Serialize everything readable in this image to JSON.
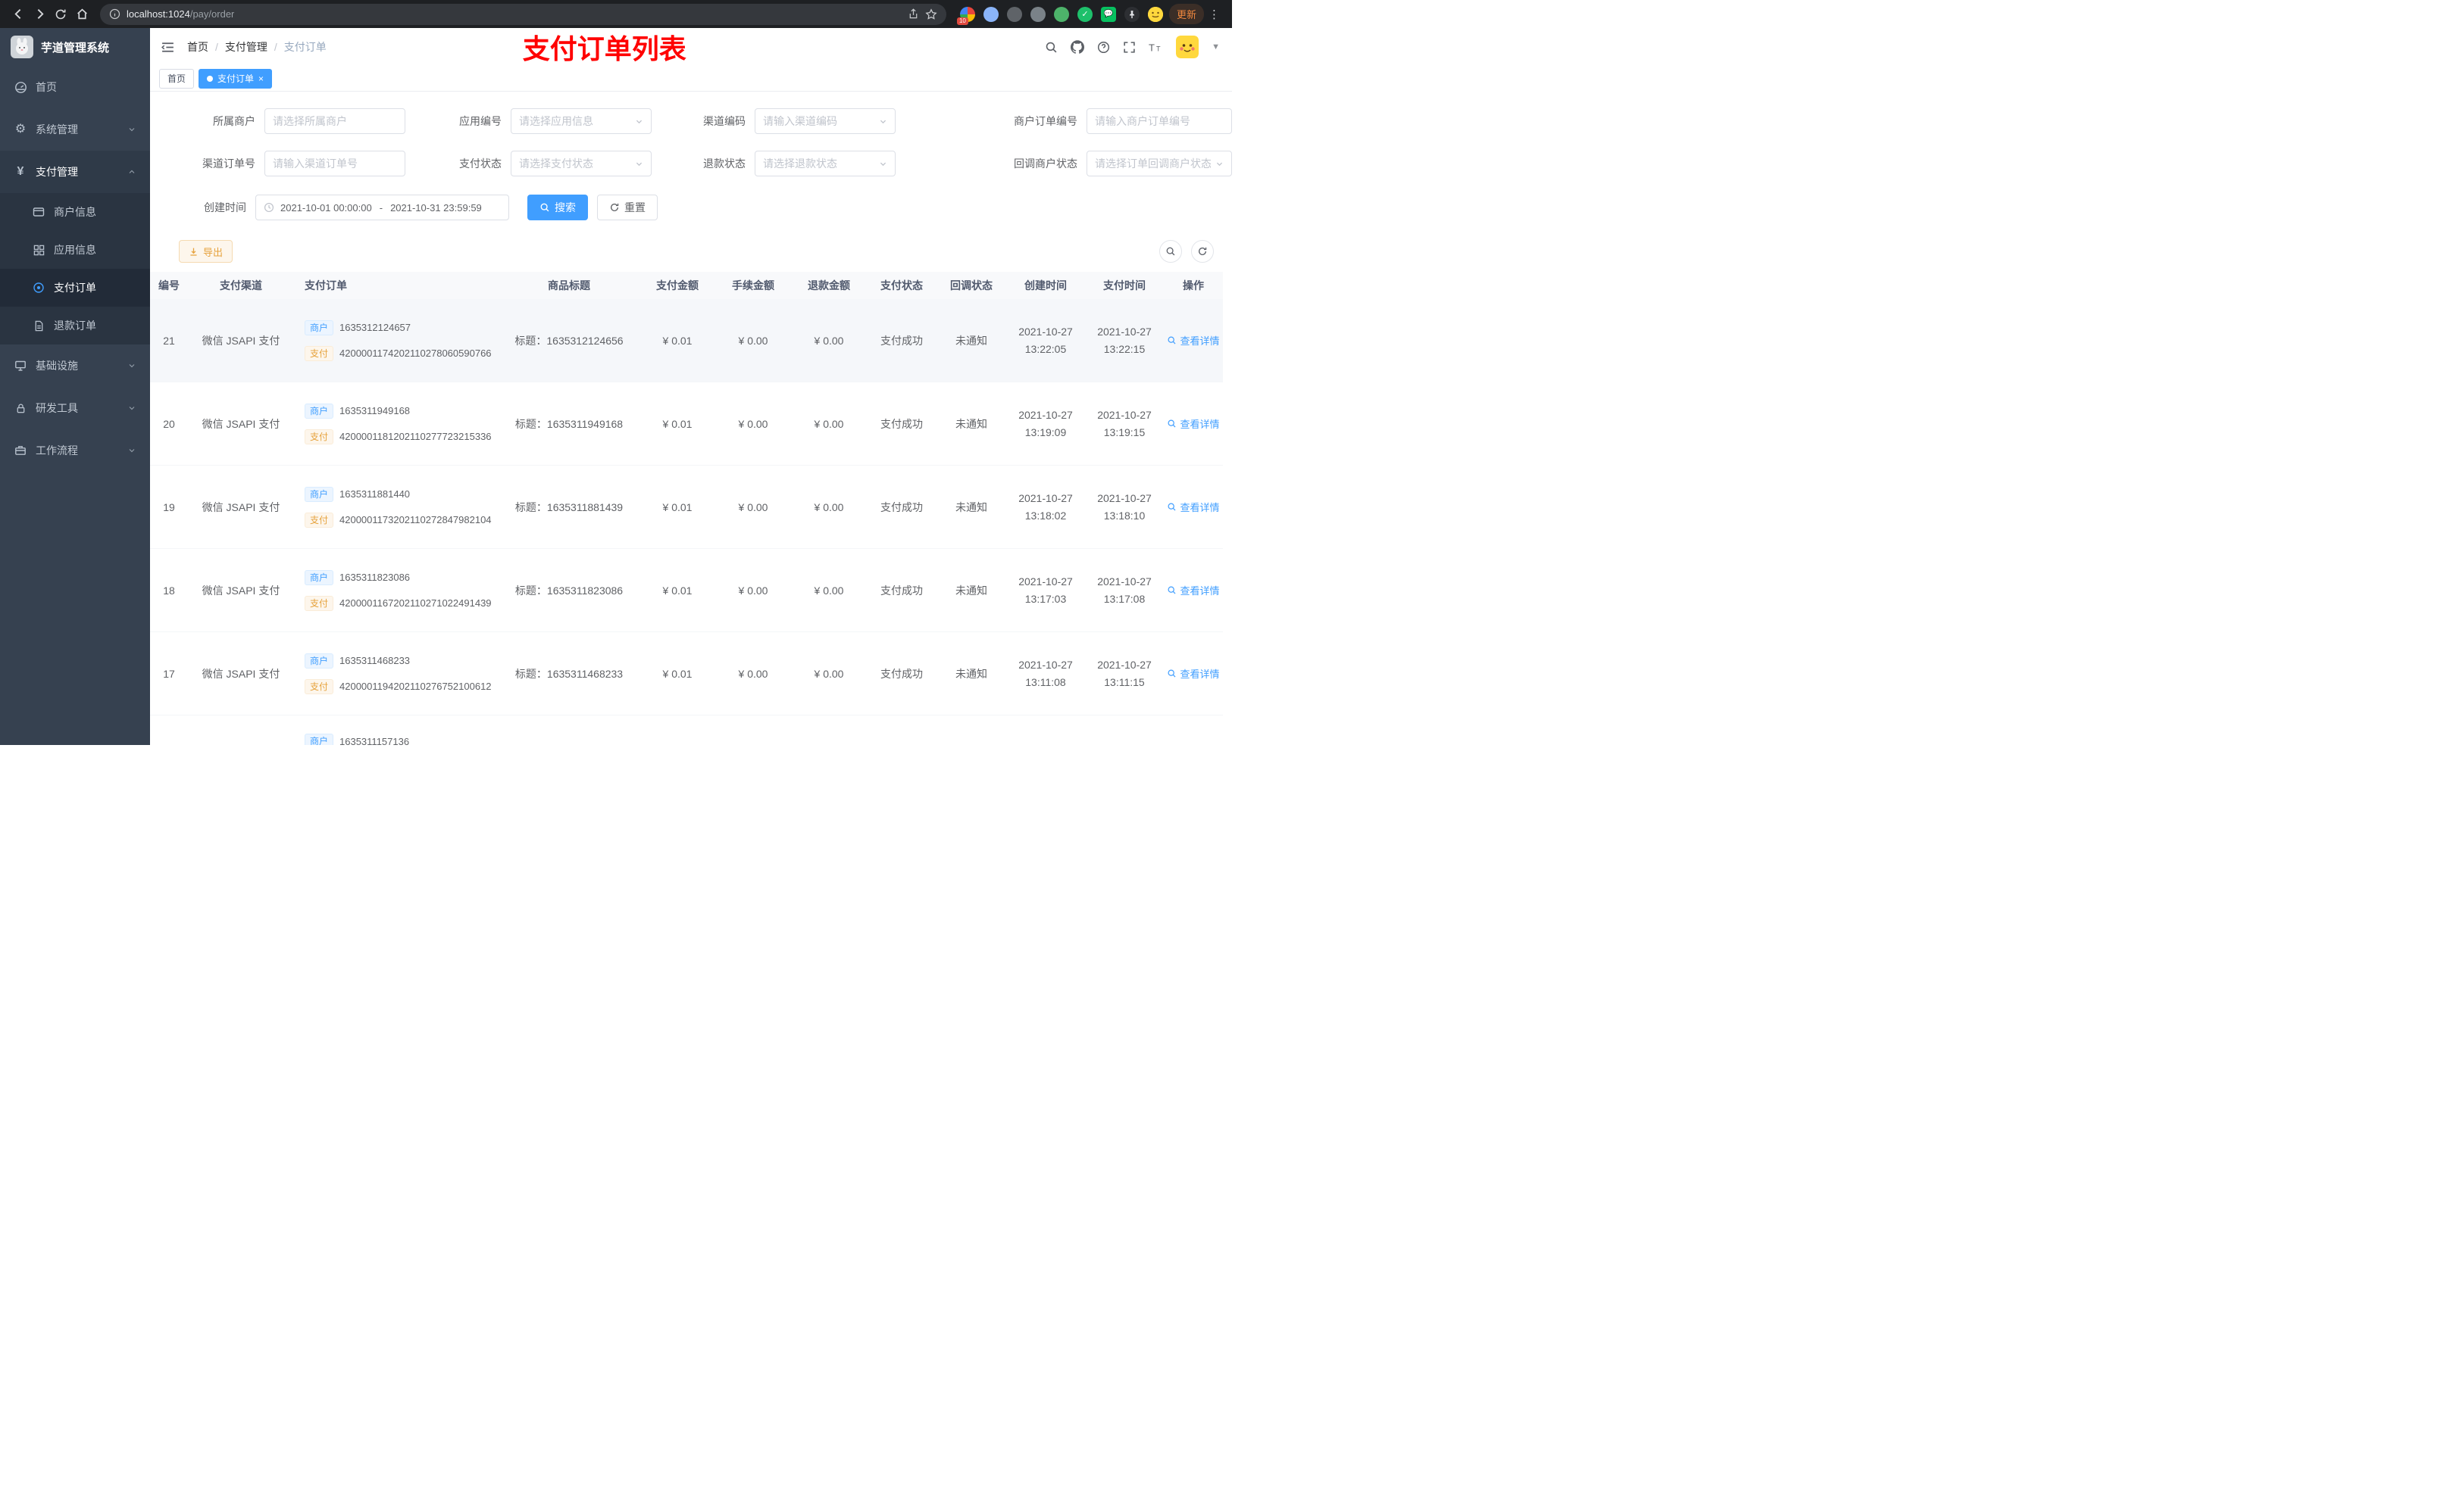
{
  "browser": {
    "url_host": "localhost:1024",
    "url_path": "/pay/order",
    "ext_badge": "10",
    "update_label": "更新"
  },
  "sidebar": {
    "app_title": "芋道管理系统",
    "items": {
      "home": "首页",
      "system": "系统管理",
      "pay": "支付管理",
      "merchant": "商户信息",
      "app": "应用信息",
      "order": "支付订单",
      "refund": "退款订单",
      "infra": "基础设施",
      "devtools": "研发工具",
      "workflow": "工作流程"
    }
  },
  "header": {
    "breadcrumb": {
      "b1": "首页",
      "b2": "支付管理",
      "b3": "支付订单"
    },
    "annotation": "支付订单列表"
  },
  "tabs": {
    "home": "首页",
    "current": "支付订单",
    "close": "×"
  },
  "filters": {
    "merchant": {
      "label": "所属商户",
      "placeholder": "请选择所属商户"
    },
    "app": {
      "label": "应用编号",
      "placeholder": "请选择应用信息"
    },
    "channel_code": {
      "label": "渠道编码",
      "placeholder": "请输入渠道编码"
    },
    "merchant_order_no": {
      "label": "商户订单编号",
      "placeholder": "请输入商户订单编号"
    },
    "channel_order_no": {
      "label": "渠道订单号",
      "placeholder": "请输入渠道订单号"
    },
    "pay_status": {
      "label": "支付状态",
      "placeholder": "请选择支付状态"
    },
    "refund_status": {
      "label": "退款状态",
      "placeholder": "请选择退款状态"
    },
    "notify_status": {
      "label": "回调商户状态",
      "placeholder": "请选择订单回调商户状态"
    },
    "create_time": {
      "label": "创建时间",
      "start": "2021-10-01 00:00:00",
      "separator": "-",
      "end": "2021-10-31 23:59:59"
    },
    "search_label": "搜索",
    "reset_label": "重置"
  },
  "toolbar": {
    "export_label": "导出"
  },
  "table": {
    "columns": [
      "编号",
      "支付渠道",
      "支付订单",
      "商品标题",
      "支付金额",
      "手续金额",
      "退款金额",
      "支付状态",
      "回调状态",
      "创建时间",
      "支付时间",
      "操作"
    ],
    "tag_merchant": "商户",
    "tag_pay": "支付",
    "action_label": "查看详情",
    "rows": [
      {
        "id": "21",
        "channel": "微信 JSAPI 支付",
        "merchant_no": "1635312124657",
        "pay_no": "4200001174202110278060590766",
        "title": "标题：1635312124656",
        "amount": "¥ 0.01",
        "fee": "¥ 0.00",
        "refund": "¥ 0.00",
        "status": "支付成功",
        "notify": "未通知",
        "create_date": "2021-10-27",
        "create_time": "13:22:05",
        "pay_date": "2021-10-27",
        "pay_time": "13:22:15"
      },
      {
        "id": "20",
        "channel": "微信 JSAPI 支付",
        "merchant_no": "1635311949168",
        "pay_no": "4200001181202110277723215336",
        "title": "标题：1635311949168",
        "amount": "¥ 0.01",
        "fee": "¥ 0.00",
        "refund": "¥ 0.00",
        "status": "支付成功",
        "notify": "未通知",
        "create_date": "2021-10-27",
        "create_time": "13:19:09",
        "pay_date": "2021-10-27",
        "pay_time": "13:19:15"
      },
      {
        "id": "19",
        "channel": "微信 JSAPI 支付",
        "merchant_no": "1635311881440",
        "pay_no": "4200001173202110272847982104",
        "title": "标题：1635311881439",
        "amount": "¥ 0.01",
        "fee": "¥ 0.00",
        "refund": "¥ 0.00",
        "status": "支付成功",
        "notify": "未通知",
        "create_date": "2021-10-27",
        "create_time": "13:18:02",
        "pay_date": "2021-10-27",
        "pay_time": "13:18:10"
      },
      {
        "id": "18",
        "channel": "微信 JSAPI 支付",
        "merchant_no": "1635311823086",
        "pay_no": "4200001167202110271022491439",
        "title": "标题：1635311823086",
        "amount": "¥ 0.01",
        "fee": "¥ 0.00",
        "refund": "¥ 0.00",
        "status": "支付成功",
        "notify": "未通知",
        "create_date": "2021-10-27",
        "create_time": "13:17:03",
        "pay_date": "2021-10-27",
        "pay_time": "13:17:08"
      },
      {
        "id": "17",
        "channel": "微信 JSAPI 支付",
        "merchant_no": "1635311468233",
        "pay_no": "4200001194202110276752100612",
        "title": "标题：1635311468233",
        "amount": "¥ 0.01",
        "fee": "¥ 0.00",
        "refund": "¥ 0.00",
        "status": "支付成功",
        "notify": "未通知",
        "create_date": "2021-10-27",
        "create_time": "13:11:08",
        "pay_date": "2021-10-27",
        "pay_time": "13:11:15"
      }
    ],
    "partial_row": {
      "merchant_no": "1635311157136"
    }
  }
}
